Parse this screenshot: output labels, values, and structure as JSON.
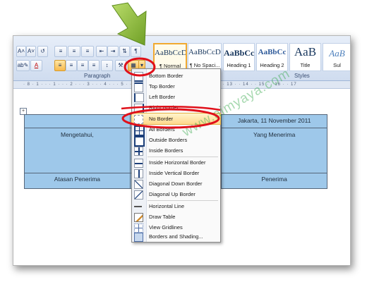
{
  "ribbon": {
    "paragraph_label": "Paragraph",
    "styles_label": "Styles",
    "buttons": {
      "grow_font": "A˄",
      "shrink_font": "A˅",
      "clear_format": "↺",
      "bullets": "≡",
      "numbering": "≡",
      "multilevel": "≡",
      "decrease_indent": "⇤",
      "increase_indent": "⇥",
      "sort": "⇅",
      "show_marks": "¶",
      "highlight": "ab✎",
      "font_color": "A",
      "align_left": "≡",
      "center": "≡",
      "align_right": "≡",
      "justify": "≡",
      "line_spacing": "↕",
      "shading": "⚒",
      "borders": "▦",
      "borders_dropdown": "▾"
    },
    "styles": [
      {
        "sample": "AaBbCcDc",
        "name": "¶ Normal",
        "active": true
      },
      {
        "sample": "AaBbCcDc",
        "name": "¶ No Spaci...",
        "active": false
      },
      {
        "sample": "AaBbCc",
        "name": "Heading 1",
        "active": false
      },
      {
        "sample": "AaBbCc",
        "name": "Heading 2",
        "active": false
      },
      {
        "sample": "AaB",
        "name": "Title",
        "active": false
      },
      {
        "sample": "AaB",
        "name": "Sul",
        "active": false
      }
    ]
  },
  "ruler_text": "· 8 · 1 · · · 1 · · · 2 · · · 3 · · · 4 · · · 5 · · · 6 · · · · · · · · · · · · · · · · · 12 · · 13 · · 14 · · 15 · · 16 · · 17",
  "table": {
    "rows": [
      [
        "",
        "",
        "Jakarta, 11 November 2011"
      ],
      [
        "Mengetahui,",
        "",
        "Yang Menerima"
      ],
      [
        "Atasan Penerima",
        "",
        "Penerima"
      ]
    ],
    "move_handle": "+"
  },
  "border_menu": {
    "items": [
      {
        "label": "Bottom Border",
        "icon": "bottom-border-icon"
      },
      {
        "label": "Top Border",
        "icon": "top-border-icon"
      },
      {
        "label": "Left Border",
        "icon": "left-border-icon"
      },
      {
        "label": "Right Border",
        "icon": "right-border-icon"
      },
      {
        "label": "No Border",
        "icon": "no-border-icon"
      },
      {
        "label": "All Borders",
        "icon": "all-borders-icon"
      },
      {
        "label": "Outside Borders",
        "icon": "outside-borders-icon"
      },
      {
        "label": "Inside Borders",
        "icon": "inside-borders-icon"
      },
      {
        "label": "Inside Horizontal Border",
        "icon": "inside-horizontal-border-icon"
      },
      {
        "label": "Inside Vertical Border",
        "icon": "inside-vertical-border-icon"
      },
      {
        "label": "Diagonal Down Border",
        "icon": "diagonal-down-border-icon"
      },
      {
        "label": "Diagonal Up Border",
        "icon": "diagonal-up-border-icon"
      },
      {
        "label": "Horizontal Line",
        "icon": "horizontal-line-icon"
      },
      {
        "label": "Draw Table",
        "icon": "draw-table-icon"
      },
      {
        "label": "View Gridlines",
        "icon": "view-gridlines-icon"
      },
      {
        "label": "Borders and Shading...",
        "icon": "borders-shading-icon"
      }
    ],
    "hovered": "No Border"
  },
  "watermark": "www.aimyaya.com",
  "colors": {
    "arrow": "#8fbf3a",
    "annotation_circle": "#e0101a",
    "table_fill": "#9ec8ea",
    "hover": "#ffd98c"
  }
}
